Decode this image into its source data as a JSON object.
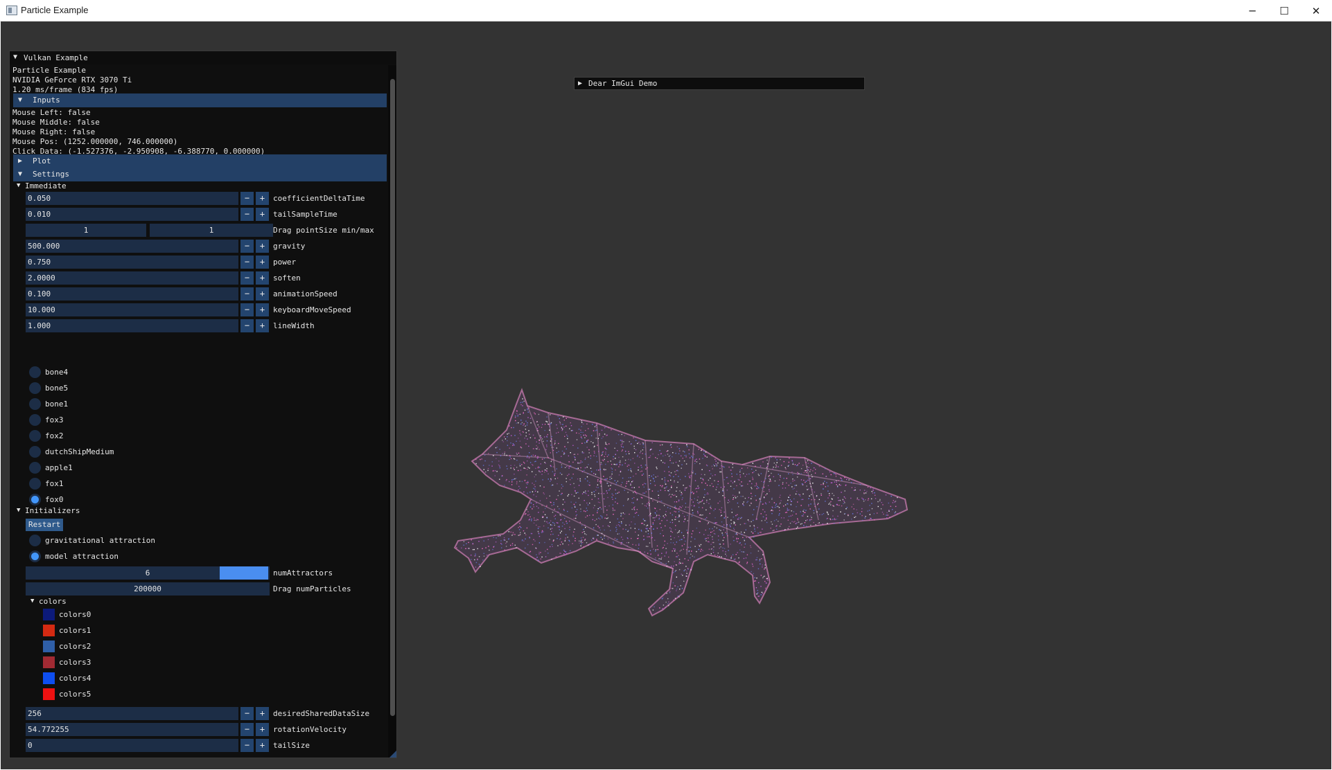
{
  "window": {
    "title": "Particle Example",
    "minimize_glyph": "─",
    "maximize_glyph": "☐",
    "close_glyph": "✕"
  },
  "demo_window": {
    "title": "Dear ImGui Demo",
    "arrow": "▶"
  },
  "panel": {
    "title": "Vulkan Example",
    "arrow": "▼",
    "info": [
      "Particle Example",
      "NVIDIA GeForce RTX 3070 Ti",
      "1.20 ms/frame (834 fps)"
    ],
    "inputs_header": "Inputs",
    "inputs": [
      "Mouse Left: false",
      "Mouse Middle: false",
      "Mouse Right: false",
      "Mouse Pos: (1252.000000, 746.000000)",
      "Click Data: (-1.527376, -2.950908, -6.388770, 0.000000)"
    ],
    "plot_header": "Plot",
    "settings_header": "Settings",
    "immediate_label": "Immediate",
    "immediate_fields_a": [
      {
        "value": "0.050",
        "label": "coefficientDeltaTime"
      },
      {
        "value": "0.010",
        "label": "tailSampleTime"
      }
    ],
    "drag_pointsize": {
      "min": "1",
      "max": "1",
      "label": "Drag pointSize min/max"
    },
    "immediate_fields_b": [
      {
        "value": "500.000",
        "label": "gravity"
      },
      {
        "value": "0.750",
        "label": "power"
      },
      {
        "value": "2.0000",
        "label": "soften"
      },
      {
        "value": "0.100",
        "label": "animationSpeed"
      },
      {
        "value": "10.000",
        "label": "keyboardMoveSpeed"
      },
      {
        "value": "1.000",
        "label": "lineWidth"
      }
    ],
    "models": [
      {
        "label": "bone4",
        "selected": false
      },
      {
        "label": "bone5",
        "selected": false
      },
      {
        "label": "bone1",
        "selected": false
      },
      {
        "label": "fox3",
        "selected": false
      },
      {
        "label": "fox2",
        "selected": false
      },
      {
        "label": "dutchShipMedium",
        "selected": false
      },
      {
        "label": "apple1",
        "selected": false
      },
      {
        "label": "fox1",
        "selected": false
      },
      {
        "label": "fox0",
        "selected": true
      }
    ],
    "initializers_label": "Initializers",
    "restart_label": "Restart",
    "attraction_modes": [
      {
        "label": "gravitational attraction",
        "selected": false
      },
      {
        "label": "model attraction",
        "selected": true
      }
    ],
    "num_attractors": {
      "value": "6",
      "label": "numAttractors"
    },
    "num_particles": {
      "value": "200000",
      "label": "Drag numParticles"
    },
    "colors_label": "colors",
    "colors": [
      {
        "label": "colors0",
        "color": "#0c1a7a"
      },
      {
        "label": "colors1",
        "color": "#d42a12"
      },
      {
        "label": "colors2",
        "color": "#2f5fa8"
      },
      {
        "label": "colors3",
        "color": "#a12a33"
      },
      {
        "label": "colors4",
        "color": "#0e4ef0"
      },
      {
        "label": "colors5",
        "color": "#ee1111"
      }
    ],
    "bottom_fields": [
      {
        "value": "256",
        "label": "desiredSharedDataSize"
      },
      {
        "value": "54.772255",
        "label": "rotationVelocity"
      },
      {
        "value": "0",
        "label": "tailSize"
      }
    ],
    "minus_glyph": "−",
    "plus_glyph": "+"
  },
  "theme": {
    "viewport_bg": "#333333",
    "header_bg": "#234066",
    "field_bg": "#1c2d46",
    "accent": "#4296fa",
    "particle_colors": [
      "#ff6fd0",
      "#c35fd8",
      "#6b7df0",
      "#ffffff"
    ]
  }
}
